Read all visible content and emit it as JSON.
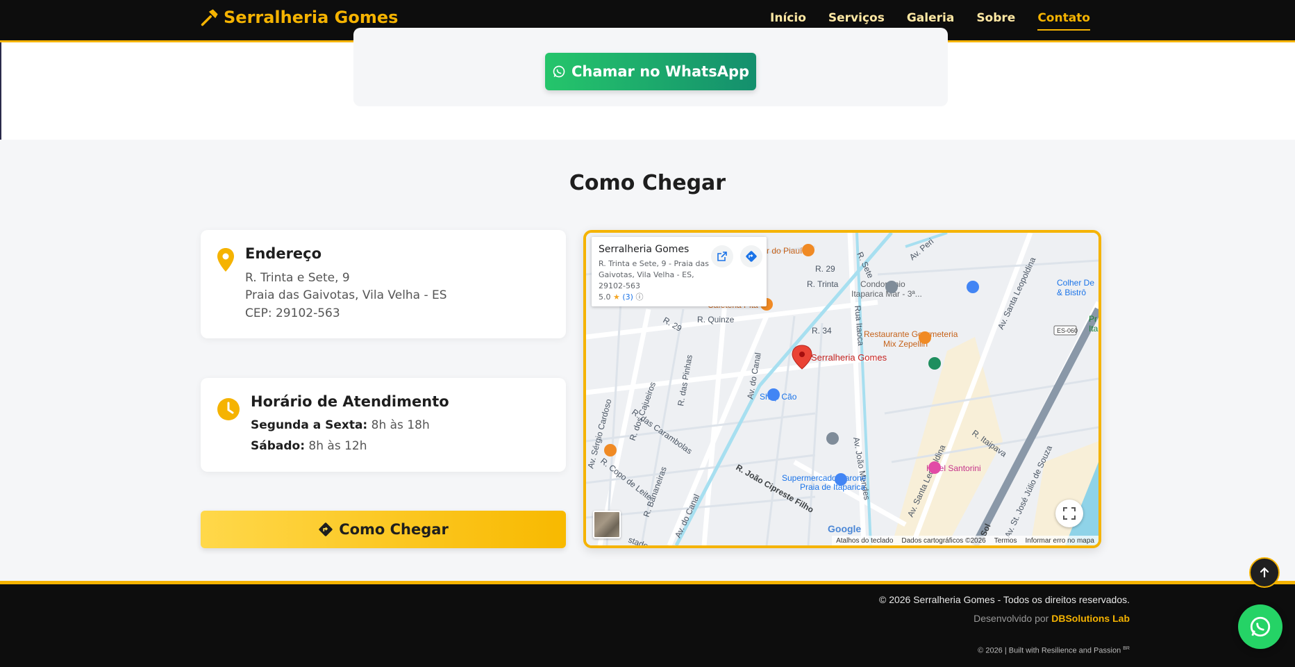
{
  "navbar": {
    "brand": "Serralheria Gomes",
    "links": [
      {
        "label": "Início"
      },
      {
        "label": "Serviços"
      },
      {
        "label": "Galeria"
      },
      {
        "label": "Sobre"
      },
      {
        "label": "Contato",
        "active": true
      }
    ]
  },
  "contact": {
    "whatsapp_label": "Chamar no WhatsApp"
  },
  "directions": {
    "title": "Como Chegar",
    "address": {
      "title": "Endereço",
      "line1": "R. Trinta e Sete, 9",
      "line2": "Praia das Gaivotas, Vila Velha - ES",
      "line3": "CEP: 29102-563"
    },
    "hours": {
      "title": "Horário de Atendimento",
      "weekday_label": "Segunda a Sexta:",
      "weekday_value": "8h às 18h",
      "saturday_label": "Sábado:",
      "saturday_value": "8h às 12h"
    },
    "route_button": "Como Chegar"
  },
  "map": {
    "place_name": "Serralheria Gomes",
    "place_address": "R. Trinta e Sete, 9 - Praia das Gaivotas, Vila Velha - ES, 29102-563",
    "rating": "5.0",
    "rating_count": "(3)",
    "marker_label": "Serralheria Gomes",
    "labels": {
      "r_quinze": "R. Quinze",
      "r29a": "R. 29",
      "r29b": "R. 29",
      "r34": "R. 34",
      "r_trinta": "R. Trinta",
      "r_sete": "R. Sete",
      "rua_itaoca": "Rua Itaoca",
      "av_do_canal": "Av. do Canal",
      "av_do_canal2": "Av. do Canal",
      "r_das_pinhas": "R. das Pinhas",
      "r_dos_cajueiros": "R. dos Cajueiros",
      "av_sergio_cardoso": "Av. Sérgio Cardoso",
      "r_das_carambolas": "R. das Carambolas",
      "r_copo_de_leite": "R. Copo de Leite",
      "r_bananeiras": "R. Bananeiras",
      "r_joao_cipreste": "R. João Cipreste Filho",
      "av_joao_mendes": "Av. João Mendes",
      "av_santa_leopoldina": "Av. Santa Leopoldina",
      "av_santa_leopoldina2": "Av. Santa Leopoldina",
      "r_itaipava": "R. Itaipava",
      "av_jose_julio": "Av. St. José Júlio de Souza",
      "sol": "Sol",
      "es060": "ES-060",
      "stade": "stade",
      "av_peri": "Av. Peri",
      "condominio": "Condomínio",
      "condominio2": "Itaparica Mar - 3ª...",
      "restaurante": "Restaurante Gourmeteria",
      "restaurante2": "Mix Zepellin",
      "colher": "Colher De",
      "colher2": "& Bistrô",
      "shop_cao": "Shop Cão",
      "supermercado": "Supermercado Carone",
      "praia": "Praia de Itaparica",
      "hotel": "Hotel Santorini",
      "piaui": "r do Piauí",
      "pr": "Pr",
      "ita": "Ita",
      "google": "Google",
      "cafe": "Cafeteria Pita"
    },
    "footer": {
      "shortcuts": "Atalhos do teclado",
      "mapdata": "Dados cartográficos ©2026",
      "terms": "Termos",
      "report": "Informar erro no mapa"
    }
  },
  "footer": {
    "copyright": "© 2026 Serralheria Gomes - Todos os direitos reservados.",
    "developed_by": "Desenvolvido por",
    "developer": "DBSolutions Lab",
    "built": "© 2026 | Built with Resilience and Passion",
    "built_sup": "BR"
  },
  "colors": {
    "accent": "#f5b301",
    "dark": "#0d0d0d",
    "whatsapp": "#25d366"
  }
}
